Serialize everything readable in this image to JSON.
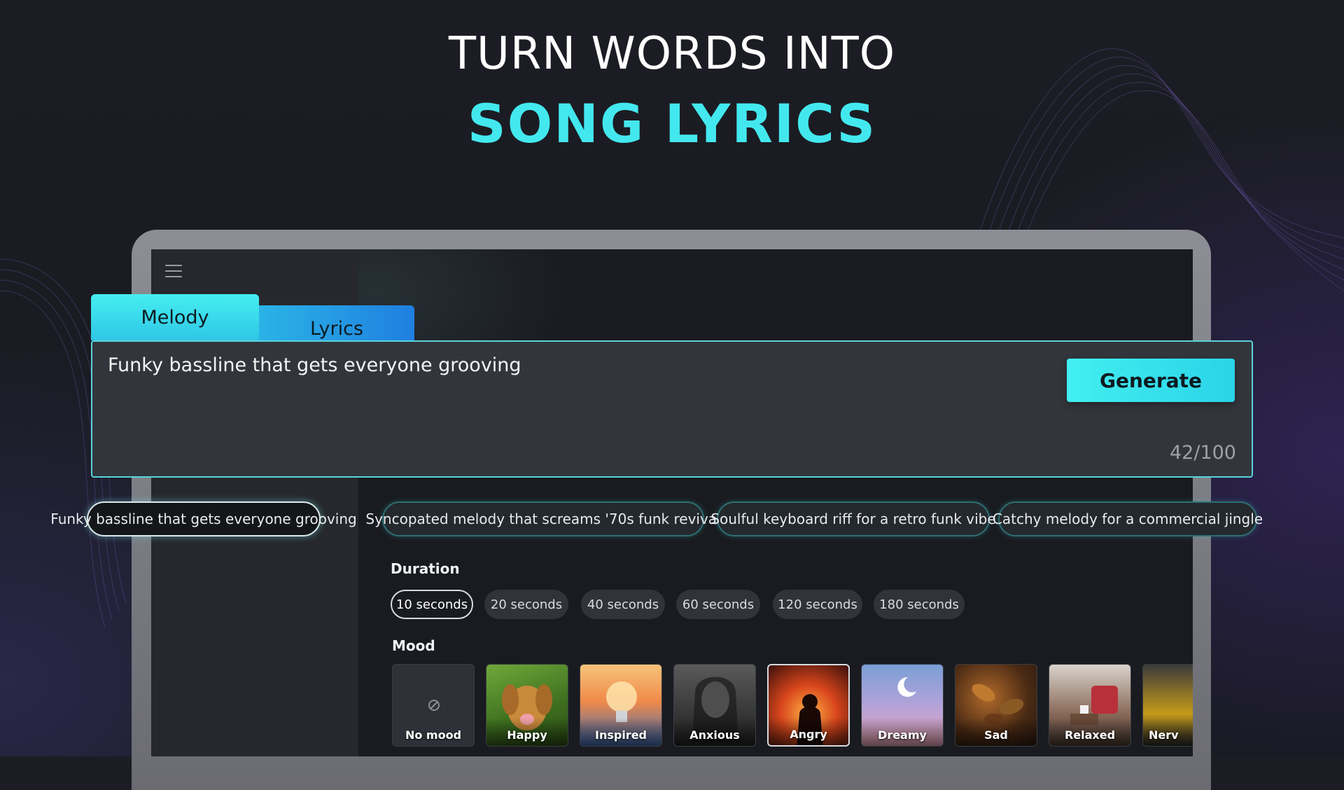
{
  "headline": {
    "line1": "TURN WORDS INTO",
    "line2": "SONG LYRICS"
  },
  "tabs": [
    {
      "label": "Melody",
      "active": true
    },
    {
      "label": "Lyrics",
      "active": false
    }
  ],
  "prompt": {
    "value": "Funky bassline that gets everyone grooving",
    "counter": "42/100",
    "generate_label": "Generate"
  },
  "suggestions": [
    {
      "label": "Funky bassline that gets everyone grooving",
      "active": true
    },
    {
      "label": "Syncopated melody that screams '70s funk revival",
      "active": false
    },
    {
      "label": "Soulful keyboard riff for a retro funk vibe",
      "active": false
    },
    {
      "label": "Catchy melody for a commercial jingle",
      "active": false
    }
  ],
  "duration": {
    "label": "Duration",
    "options": [
      "10 seconds",
      "20 seconds",
      "40 seconds",
      "60 seconds",
      "120 seconds",
      "180 seconds"
    ],
    "selected": "10 seconds"
  },
  "mood": {
    "label": "Mood",
    "options": [
      {
        "label": "No mood",
        "icon": "no-mood-icon"
      },
      {
        "label": "Happy"
      },
      {
        "label": "Inspired"
      },
      {
        "label": "Anxious"
      },
      {
        "label": "Angry",
        "selected": true
      },
      {
        "label": "Dreamy"
      },
      {
        "label": "Sad"
      },
      {
        "label": "Relaxed"
      },
      {
        "label": "Nerv"
      }
    ]
  },
  "colors": {
    "accent": "#43e8ee",
    "background": "#1b1c22",
    "panel": "#32363c"
  }
}
